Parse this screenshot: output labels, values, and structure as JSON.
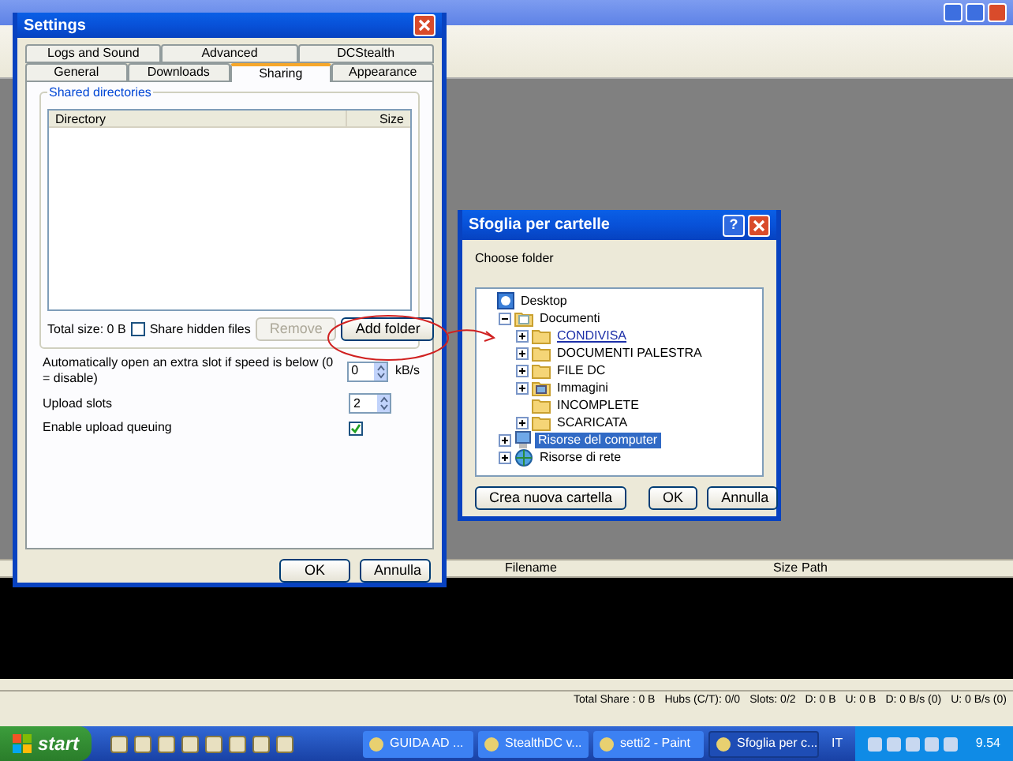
{
  "main_window": {
    "columns": [
      "Filename",
      "Size",
      "Path"
    ],
    "status_bar": [
      "Total Share : 0 B",
      "Hubs (C/T): 0/0",
      "Slots: 0/2",
      "D: 0 B",
      "U: 0 B",
      "D: 0 B/s (0)",
      "U: 0 B/s (0)"
    ]
  },
  "settings": {
    "title": "Settings",
    "tab_rows": [
      [
        {
          "label": "Logs and Sound",
          "selected": false
        },
        {
          "label": "Advanced",
          "selected": false
        },
        {
          "label": "DCStealth",
          "selected": false
        }
      ],
      [
        {
          "label": "General",
          "selected": false
        },
        {
          "label": "Downloads",
          "selected": false
        },
        {
          "label": "Sharing",
          "selected": true
        },
        {
          "label": "Appearance",
          "selected": false
        }
      ]
    ],
    "group_title": "Shared directories",
    "list_columns": [
      "Directory",
      "Size"
    ],
    "total_size": "Total size: 0 B",
    "share_hidden": {
      "label": "Share hidden files",
      "checked": false
    },
    "remove_button": {
      "label": "Remove",
      "disabled": true
    },
    "add_button": {
      "label": "Add folder",
      "disabled": false
    },
    "options": [
      {
        "kind": "spinner",
        "label": "Automatically open an extra slot if speed is below (0 = disable)",
        "value": "0",
        "unit": "kB/s"
      },
      {
        "kind": "spinner",
        "label": "Upload slots",
        "value": "2"
      },
      {
        "kind": "checkbox",
        "label": "Enable upload queuing",
        "checked": true
      }
    ],
    "buttons": [
      "OK",
      "Annulla"
    ]
  },
  "browse": {
    "title": "Sfoglia per cartelle",
    "help": "?",
    "prompt": "Choose folder",
    "tree": [
      {
        "label": "Desktop",
        "kind": "desktop",
        "selected": false,
        "hot": false,
        "children": [
          {
            "label": "Documenti",
            "kind": "documents",
            "expanded": true,
            "selected": false,
            "hot": false,
            "children": [
              {
                "label": "CONDIVISA",
                "kind": "folder",
                "expanded": false,
                "selected": false,
                "hot": true
              },
              {
                "label": "DOCUMENTI PALESTRA",
                "kind": "folder",
                "expanded": false,
                "selected": false,
                "hot": false
              },
              {
                "label": "FILE DC",
                "kind": "folder",
                "expanded": false,
                "selected": false,
                "hot": false
              },
              {
                "label": "Immagini",
                "kind": "pictures",
                "expanded": false,
                "selected": false,
                "hot": false
              },
              {
                "label": "INCOMPLETE",
                "kind": "folder",
                "selected": false,
                "hot": false
              },
              {
                "label": "SCARICATA",
                "kind": "folder",
                "expanded": false,
                "selected": false,
                "hot": false
              }
            ]
          },
          {
            "label": "Risorse del computer",
            "kind": "computer",
            "expanded": false,
            "selected": true,
            "hot": false
          },
          {
            "label": "Risorse di rete",
            "kind": "network",
            "expanded": false,
            "selected": false,
            "hot": false
          }
        ]
      }
    ],
    "buttons": [
      "Crea nuova cartella",
      "OK",
      "Annulla"
    ]
  },
  "taskbar": {
    "start": "start",
    "tasks": [
      {
        "label": "GUIDA AD ...",
        "selected": false
      },
      {
        "label": "StealthDC v...",
        "selected": false
      },
      {
        "label": "setti2 - Paint",
        "selected": false
      },
      {
        "label": "Sfoglia per c...",
        "selected": true
      }
    ],
    "language": "IT",
    "clock": "9.54"
  }
}
